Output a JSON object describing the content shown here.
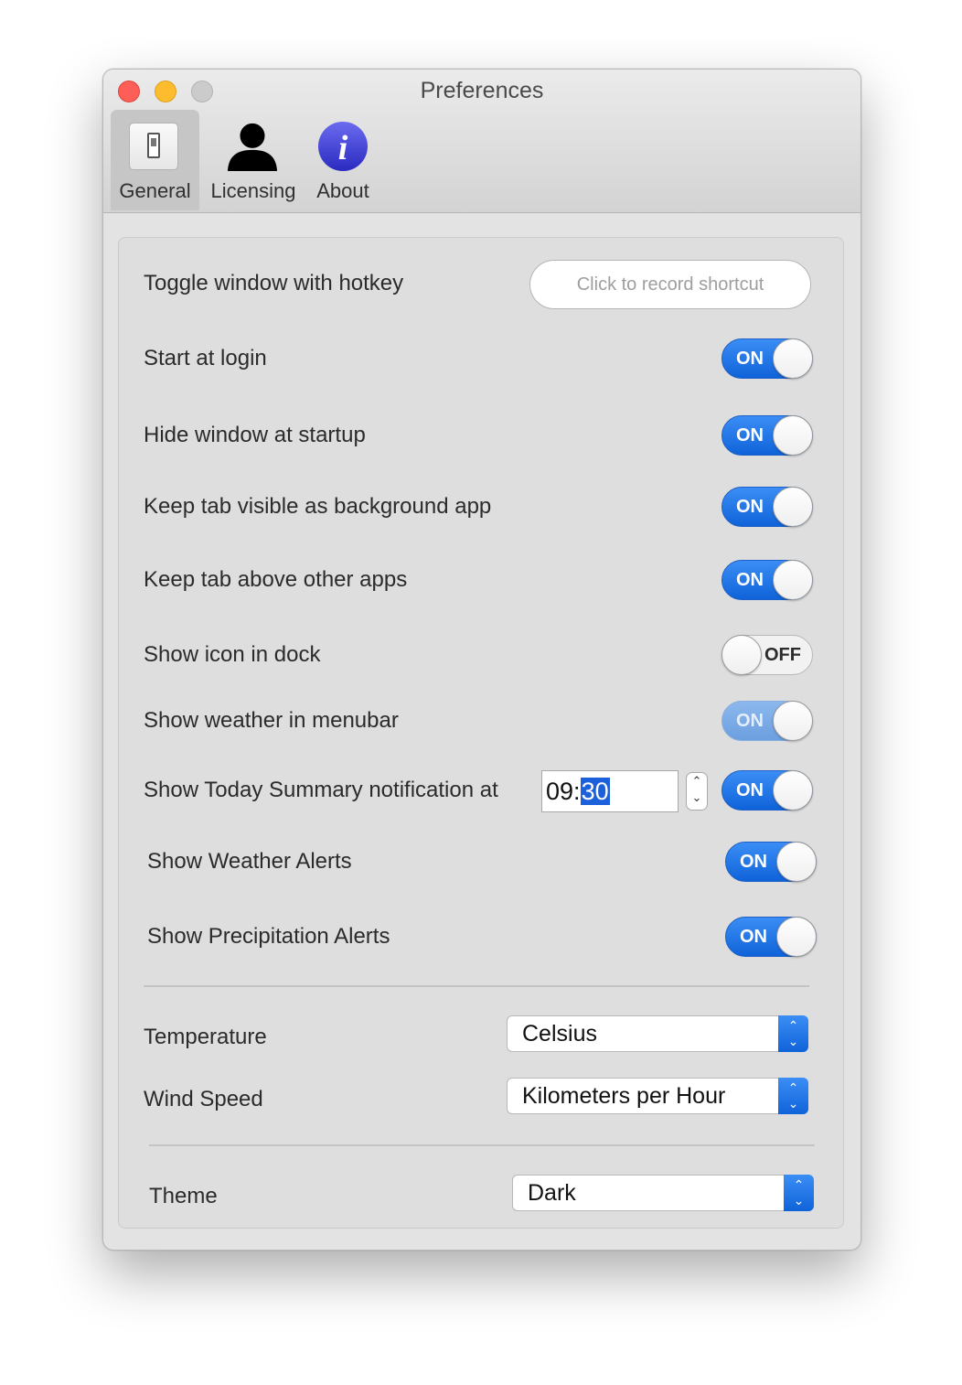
{
  "window": {
    "title": "Preferences"
  },
  "tabs": [
    {
      "label": "General",
      "icon": "switch-icon",
      "active": true
    },
    {
      "label": "Licensing",
      "icon": "person-icon",
      "active": false
    },
    {
      "label": "About",
      "icon": "info-icon",
      "active": false
    }
  ],
  "general": {
    "hotkey": {
      "label": "Toggle window with hotkey",
      "button": "Click to record shortcut"
    },
    "rows": [
      {
        "label": "Start at login",
        "state": "ON"
      },
      {
        "label": "Hide window at startup",
        "state": "ON"
      },
      {
        "label": "Keep tab visible as background app",
        "state": "ON"
      },
      {
        "label": "Keep tab above other apps",
        "state": "ON"
      },
      {
        "label": "Show icon in dock",
        "state": "OFF"
      },
      {
        "label": "Show weather in menubar",
        "state": "ON",
        "disabled": true
      },
      {
        "label": "Show Today Summary notification at",
        "state": "ON"
      },
      {
        "label": "Show Weather Alerts",
        "state": "ON"
      },
      {
        "label": "Show Precipitation Alerts",
        "state": "ON"
      }
    ],
    "summary_time": {
      "hours": "09",
      "separator": ":",
      "minutes": "30"
    },
    "temperature": {
      "label": "Temperature",
      "value": "Celsius"
    },
    "wind_speed": {
      "label": "Wind Speed",
      "value": "Kilometers per Hour"
    },
    "theme": {
      "label": "Theme",
      "value": "Dark"
    }
  },
  "colors": {
    "accent": "#1a6ce0",
    "close": "#fd5e57",
    "minimize": "#fdbb2e",
    "zoom": "#cbcbcb"
  }
}
